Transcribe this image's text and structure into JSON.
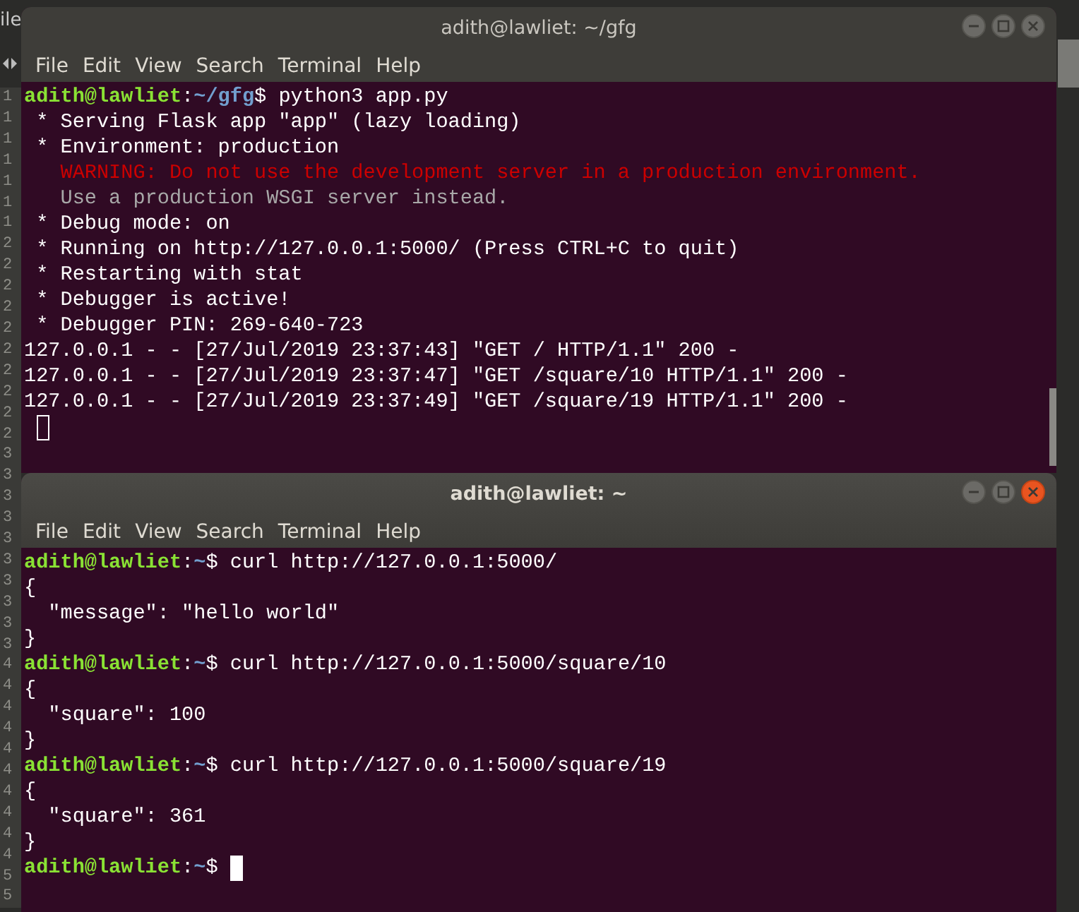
{
  "background_editor": {
    "tab_label": "ile",
    "line_numbers": [
      "1",
      "1",
      "1",
      "1",
      "1",
      "1",
      "1",
      "2",
      "2",
      "2",
      "2",
      "2",
      "2",
      "2",
      "2",
      "2",
      "2",
      "3",
      "3",
      "3",
      "3",
      "3",
      "3",
      "3",
      "3",
      "3",
      "3",
      "4",
      "4",
      "4",
      "4",
      "4",
      "4",
      "4",
      "4",
      "4",
      "4",
      "5",
      "5"
    ]
  },
  "windows": [
    {
      "title": "adith@lawliet: ~/gfg",
      "focused": false,
      "menu": [
        "File",
        "Edit",
        "View",
        "Search",
        "Terminal",
        "Help"
      ],
      "lines": [
        {
          "kind": "prompt",
          "user": "adith@lawliet",
          "colon": ":",
          "path": "~/gfg",
          "rest": "$ python3 app.py"
        },
        {
          "kind": "output",
          "text": " * Serving Flask app \"app\" (lazy loading)"
        },
        {
          "kind": "output",
          "text": " * Environment: production"
        },
        {
          "kind": "warning",
          "text": "   WARNING: Do not use the development server in a production environment."
        },
        {
          "kind": "dim",
          "text": "   Use a production WSGI server instead."
        },
        {
          "kind": "output",
          "text": " * Debug mode: on"
        },
        {
          "kind": "output",
          "text": " * Running on http://127.0.0.1:5000/ (Press CTRL+C to quit)"
        },
        {
          "kind": "output",
          "text": " * Restarting with stat"
        },
        {
          "kind": "output",
          "text": " * Debugger is active!"
        },
        {
          "kind": "output",
          "text": " * Debugger PIN: 269-640-723"
        },
        {
          "kind": "output",
          "text": "127.0.0.1 - - [27/Jul/2019 23:37:43] \"GET / HTTP/1.1\" 200 -"
        },
        {
          "kind": "output",
          "text": "127.0.0.1 - - [27/Jul/2019 23:37:47] \"GET /square/10 HTTP/1.1\" 200 -"
        },
        {
          "kind": "output",
          "text": "127.0.0.1 - - [27/Jul/2019 23:37:49] \"GET /square/19 HTTP/1.1\" 200 -"
        },
        {
          "kind": "cursor"
        }
      ]
    },
    {
      "title": "adith@lawliet: ~",
      "focused": true,
      "menu": [
        "File",
        "Edit",
        "View",
        "Search",
        "Terminal",
        "Help"
      ],
      "lines": [
        {
          "kind": "prompt",
          "user": "adith@lawliet",
          "colon": ":",
          "path": "~",
          "rest": "$ curl http://127.0.0.1:5000/"
        },
        {
          "kind": "output",
          "text": "{"
        },
        {
          "kind": "output",
          "text": "  \"message\": \"hello world\""
        },
        {
          "kind": "output",
          "text": "}"
        },
        {
          "kind": "prompt",
          "user": "adith@lawliet",
          "colon": ":",
          "path": "~",
          "rest": "$ curl http://127.0.0.1:5000/square/10"
        },
        {
          "kind": "output",
          "text": "{"
        },
        {
          "kind": "output",
          "text": "  \"square\": 100"
        },
        {
          "kind": "output",
          "text": "}"
        },
        {
          "kind": "prompt",
          "user": "adith@lawliet",
          "colon": ":",
          "path": "~",
          "rest": "$ curl http://127.0.0.1:5000/square/19"
        },
        {
          "kind": "output",
          "text": "{"
        },
        {
          "kind": "output",
          "text": "  \"square\": 361"
        },
        {
          "kind": "output",
          "text": "}"
        },
        {
          "kind": "prompt",
          "user": "adith@lawliet",
          "colon": ":",
          "path": "~",
          "rest": "$"
        },
        {
          "kind": "cursor"
        }
      ]
    }
  ]
}
